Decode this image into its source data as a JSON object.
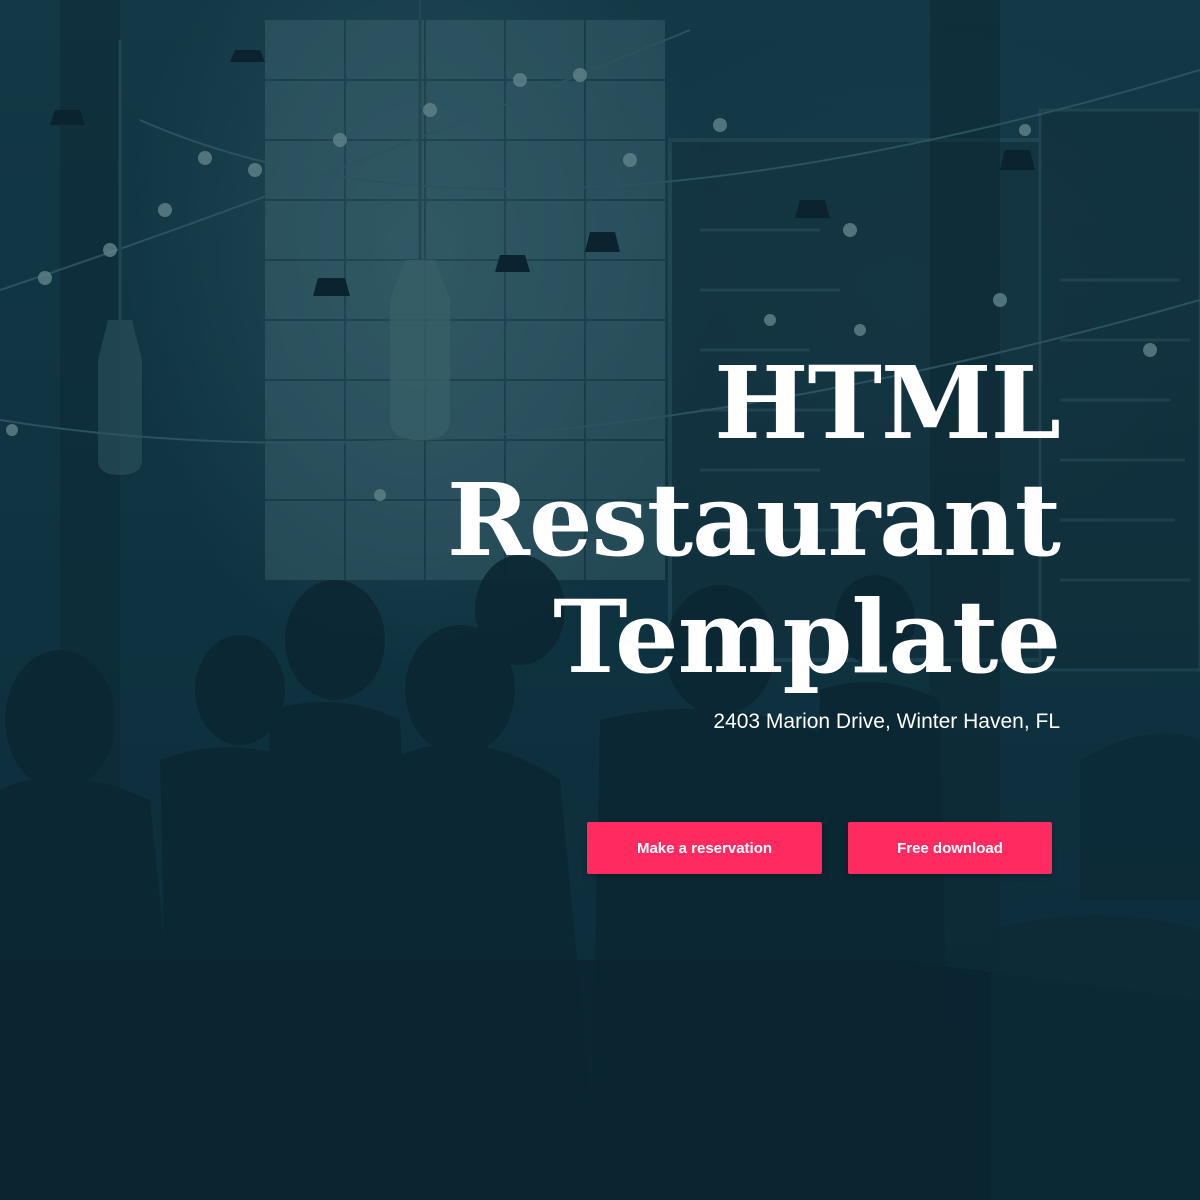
{
  "hero": {
    "title_lines": [
      "HTML",
      "Restaurant",
      "Template"
    ],
    "address": "2403 Marion Drive, Winter Haven, FL",
    "actions": {
      "reservation_label": "Make a reservation",
      "download_label": "Free download"
    }
  },
  "colors": {
    "accent": "#ff2a5f",
    "overlay": "#0f2f3c",
    "text": "#ffffff"
  },
  "icons": [
    "string-lights-icon",
    "pendant-lamp-icon",
    "menu-board-icon"
  ]
}
